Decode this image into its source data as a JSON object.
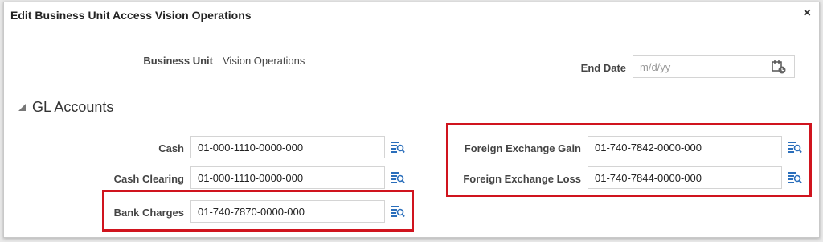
{
  "dialog": {
    "title": "Edit Business Unit Access Vision Operations",
    "close_label": "×"
  },
  "header": {
    "business_unit_label": "Business Unit",
    "business_unit_value": "Vision Operations",
    "end_date_label": "End Date",
    "end_date_placeholder": "m/d/yy"
  },
  "section": {
    "title": "GL Accounts"
  },
  "accounts_left": [
    {
      "label": "Cash",
      "value": "01-000-1110-0000-000"
    },
    {
      "label": "Cash Clearing",
      "value": "01-000-1110-0000-000"
    },
    {
      "label": "Bank Charges",
      "value": "01-740-7870-0000-000"
    }
  ],
  "accounts_right": [
    {
      "label": "Foreign Exchange Gain",
      "value": "01-740-7842-0000-000"
    },
    {
      "label": "Foreign Exchange Loss",
      "value": "01-740-7844-0000-000"
    }
  ],
  "icons": {
    "search": "account-search-icon",
    "calendar": "calendar-icon",
    "collapse": "collapse-triangle-icon"
  },
  "colors": {
    "highlight": "#d0141e",
    "icon_blue": "#2a6ebb"
  }
}
